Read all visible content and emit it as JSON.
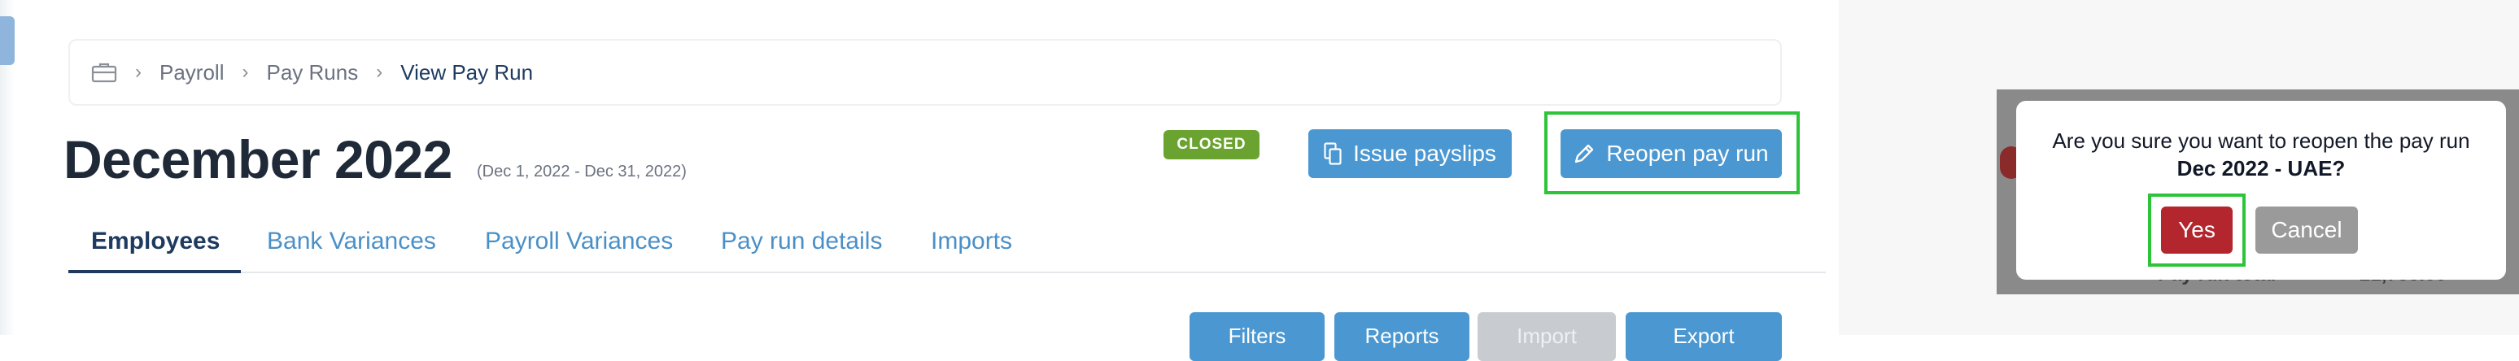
{
  "breadcrumb": {
    "items": [
      "Payroll",
      "Pay Runs",
      "View Pay Run"
    ],
    "icon": "briefcase-icon"
  },
  "header": {
    "title": "December 2022",
    "date_range": "(Dec 1, 2022 - Dec 31, 2022)",
    "status": "CLOSED",
    "status_color": "#6aa32f"
  },
  "actions": {
    "issue_payslips": "Issue payslips",
    "reopen_pay_run": "Reopen pay run"
  },
  "tabs": [
    {
      "label": "Employees",
      "active": true
    },
    {
      "label": "Bank Variances"
    },
    {
      "label": "Payroll Variances"
    },
    {
      "label": "Pay run details"
    },
    {
      "label": "Imports"
    }
  ],
  "toolbar": {
    "filters": "Filters",
    "reports": "Reports",
    "import": "Import",
    "export": "Export"
  },
  "background_content": {
    "label": "Pay run total",
    "amount": "21,755.00"
  },
  "dialog": {
    "message": "Are you sure you want to reopen the pay run",
    "subject": "Dec 2022 - UAE?",
    "yes": "Yes",
    "cancel": "Cancel"
  },
  "colors": {
    "primary": "#4a97d1",
    "danger": "#b3262d",
    "highlight": "#2ec43a",
    "arrow": "#7dc35b"
  }
}
